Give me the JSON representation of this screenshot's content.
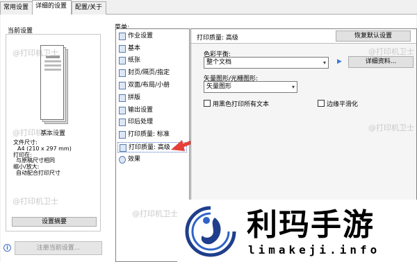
{
  "tabs": [
    "常用设置",
    "详细的设置",
    "配置/关于"
  ],
  "left_panel": {
    "title": "当前设置",
    "summary_title": "基本设置",
    "info_lines": [
      "文件尺寸:",
      "A4 (210 x 297 mm)",
      "打印在:",
      "与原稿尺寸相同",
      "缩小/放大:",
      "自动配合打印尺寸"
    ],
    "summary_button": "设置摘要",
    "register_button": "注册当前设置..."
  },
  "menu": {
    "label": "菜单:",
    "items": [
      "作业设置",
      "基本",
      "纸张",
      "封页/隔页/指定",
      "双面/布局/小册",
      "拼版",
      "输出设置",
      "印后处理",
      "打印质量: 标准",
      "打印质量: 高级",
      "效果"
    ],
    "selected_index": 9
  },
  "main": {
    "header_title": "打印质量: 高级",
    "restore_button": "恢复默认设置",
    "color_balance_label": "色彩平衡:",
    "color_balance_value": "整个文档",
    "detail_button": "详细资料...",
    "vector_label": "矢量图形/光栅图形:",
    "vector_value": "矢量图形",
    "print_all_black_label": "用黑色打印所有文本",
    "edge_smoothing_label": "边缘平滑化"
  },
  "watermark": {
    "text": "@打印机卫士",
    "brand_cn": "利玛手游",
    "brand_en": "limakeji.info"
  },
  "colors": {
    "accent_red": "#e5403a",
    "brand_blue": "#1f3f8c"
  }
}
